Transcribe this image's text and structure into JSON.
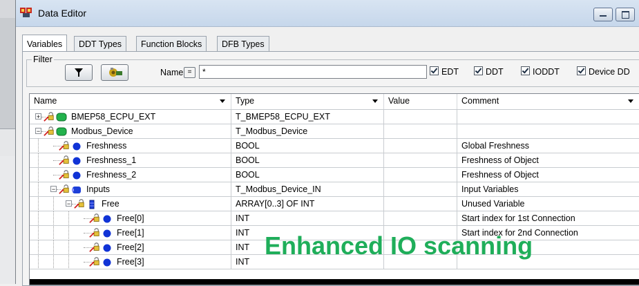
{
  "window": {
    "title": "Data Editor"
  },
  "tabs": [
    {
      "label": "Variables",
      "active": true
    },
    {
      "label": "DDT Types",
      "active": false
    },
    {
      "label": "Function Blocks",
      "active": false
    },
    {
      "label": "DFB Types",
      "active": false
    }
  ],
  "filter": {
    "label": "Filter",
    "name_label": "Name",
    "eq_label": "=",
    "name_value": "*",
    "checks": [
      {
        "label": "EDT",
        "checked": true
      },
      {
        "label": "DDT",
        "checked": true
      },
      {
        "label": "IODDT",
        "checked": true
      },
      {
        "label": "Device DD",
        "checked": true
      }
    ]
  },
  "grid": {
    "columns": [
      "Name",
      "Type",
      "Value",
      "Comment"
    ],
    "rows": [
      {
        "name": "BMEP58_ECPU_EXT",
        "type": "T_BMEP58_ECPU_EXT",
        "value": "",
        "comment": "",
        "level": 0,
        "expander": "+",
        "kind": "device"
      },
      {
        "name": "Modbus_Device",
        "type": "T_Modbus_Device",
        "value": "",
        "comment": "",
        "level": 0,
        "expander": "-",
        "kind": "device"
      },
      {
        "name": "Freshness",
        "type": "BOOL",
        "value": "",
        "comment": "Global Freshness",
        "level": 1,
        "expander": "",
        "kind": "dot"
      },
      {
        "name": "Freshness_1",
        "type": "BOOL",
        "value": "",
        "comment": "Freshness of Object",
        "level": 1,
        "expander": "",
        "kind": "dot"
      },
      {
        "name": "Freshness_2",
        "type": "BOOL",
        "value": "",
        "comment": "Freshness of Object",
        "level": 1,
        "expander": "",
        "kind": "dot"
      },
      {
        "name": "Inputs",
        "type": "T_Modbus_Device_IN",
        "value": "",
        "comment": "Input Variables",
        "level": 1,
        "expander": "-",
        "kind": "struct"
      },
      {
        "name": "Free",
        "type": "ARRAY[0..3] OF INT",
        "value": "",
        "comment": "Unused Variable",
        "level": 2,
        "expander": "-",
        "kind": "array"
      },
      {
        "name": "Free[0]",
        "type": "INT",
        "value": "",
        "comment": "Start index for 1st Connection",
        "level": 3,
        "expander": "",
        "kind": "dot"
      },
      {
        "name": "Free[1]",
        "type": "INT",
        "value": "",
        "comment": "Start index for 2nd Connection",
        "level": 3,
        "expander": "",
        "kind": "dot"
      },
      {
        "name": "Free[2]",
        "type": "INT",
        "value": "",
        "comment": "",
        "level": 3,
        "expander": "",
        "kind": "dot"
      },
      {
        "name": "Free[3]",
        "type": "INT",
        "value": "",
        "comment": "",
        "level": 3,
        "expander": "",
        "kind": "dot"
      }
    ]
  },
  "overlay": {
    "text": "Enhanced IO scanning",
    "color": "#1fae5a"
  },
  "icons": [
    "app-icon",
    "filter-funnel-icon",
    "filter-config-icon",
    "lock-icon",
    "device-icon",
    "bool-dot-icon",
    "struct-icon",
    "array-icon"
  ]
}
